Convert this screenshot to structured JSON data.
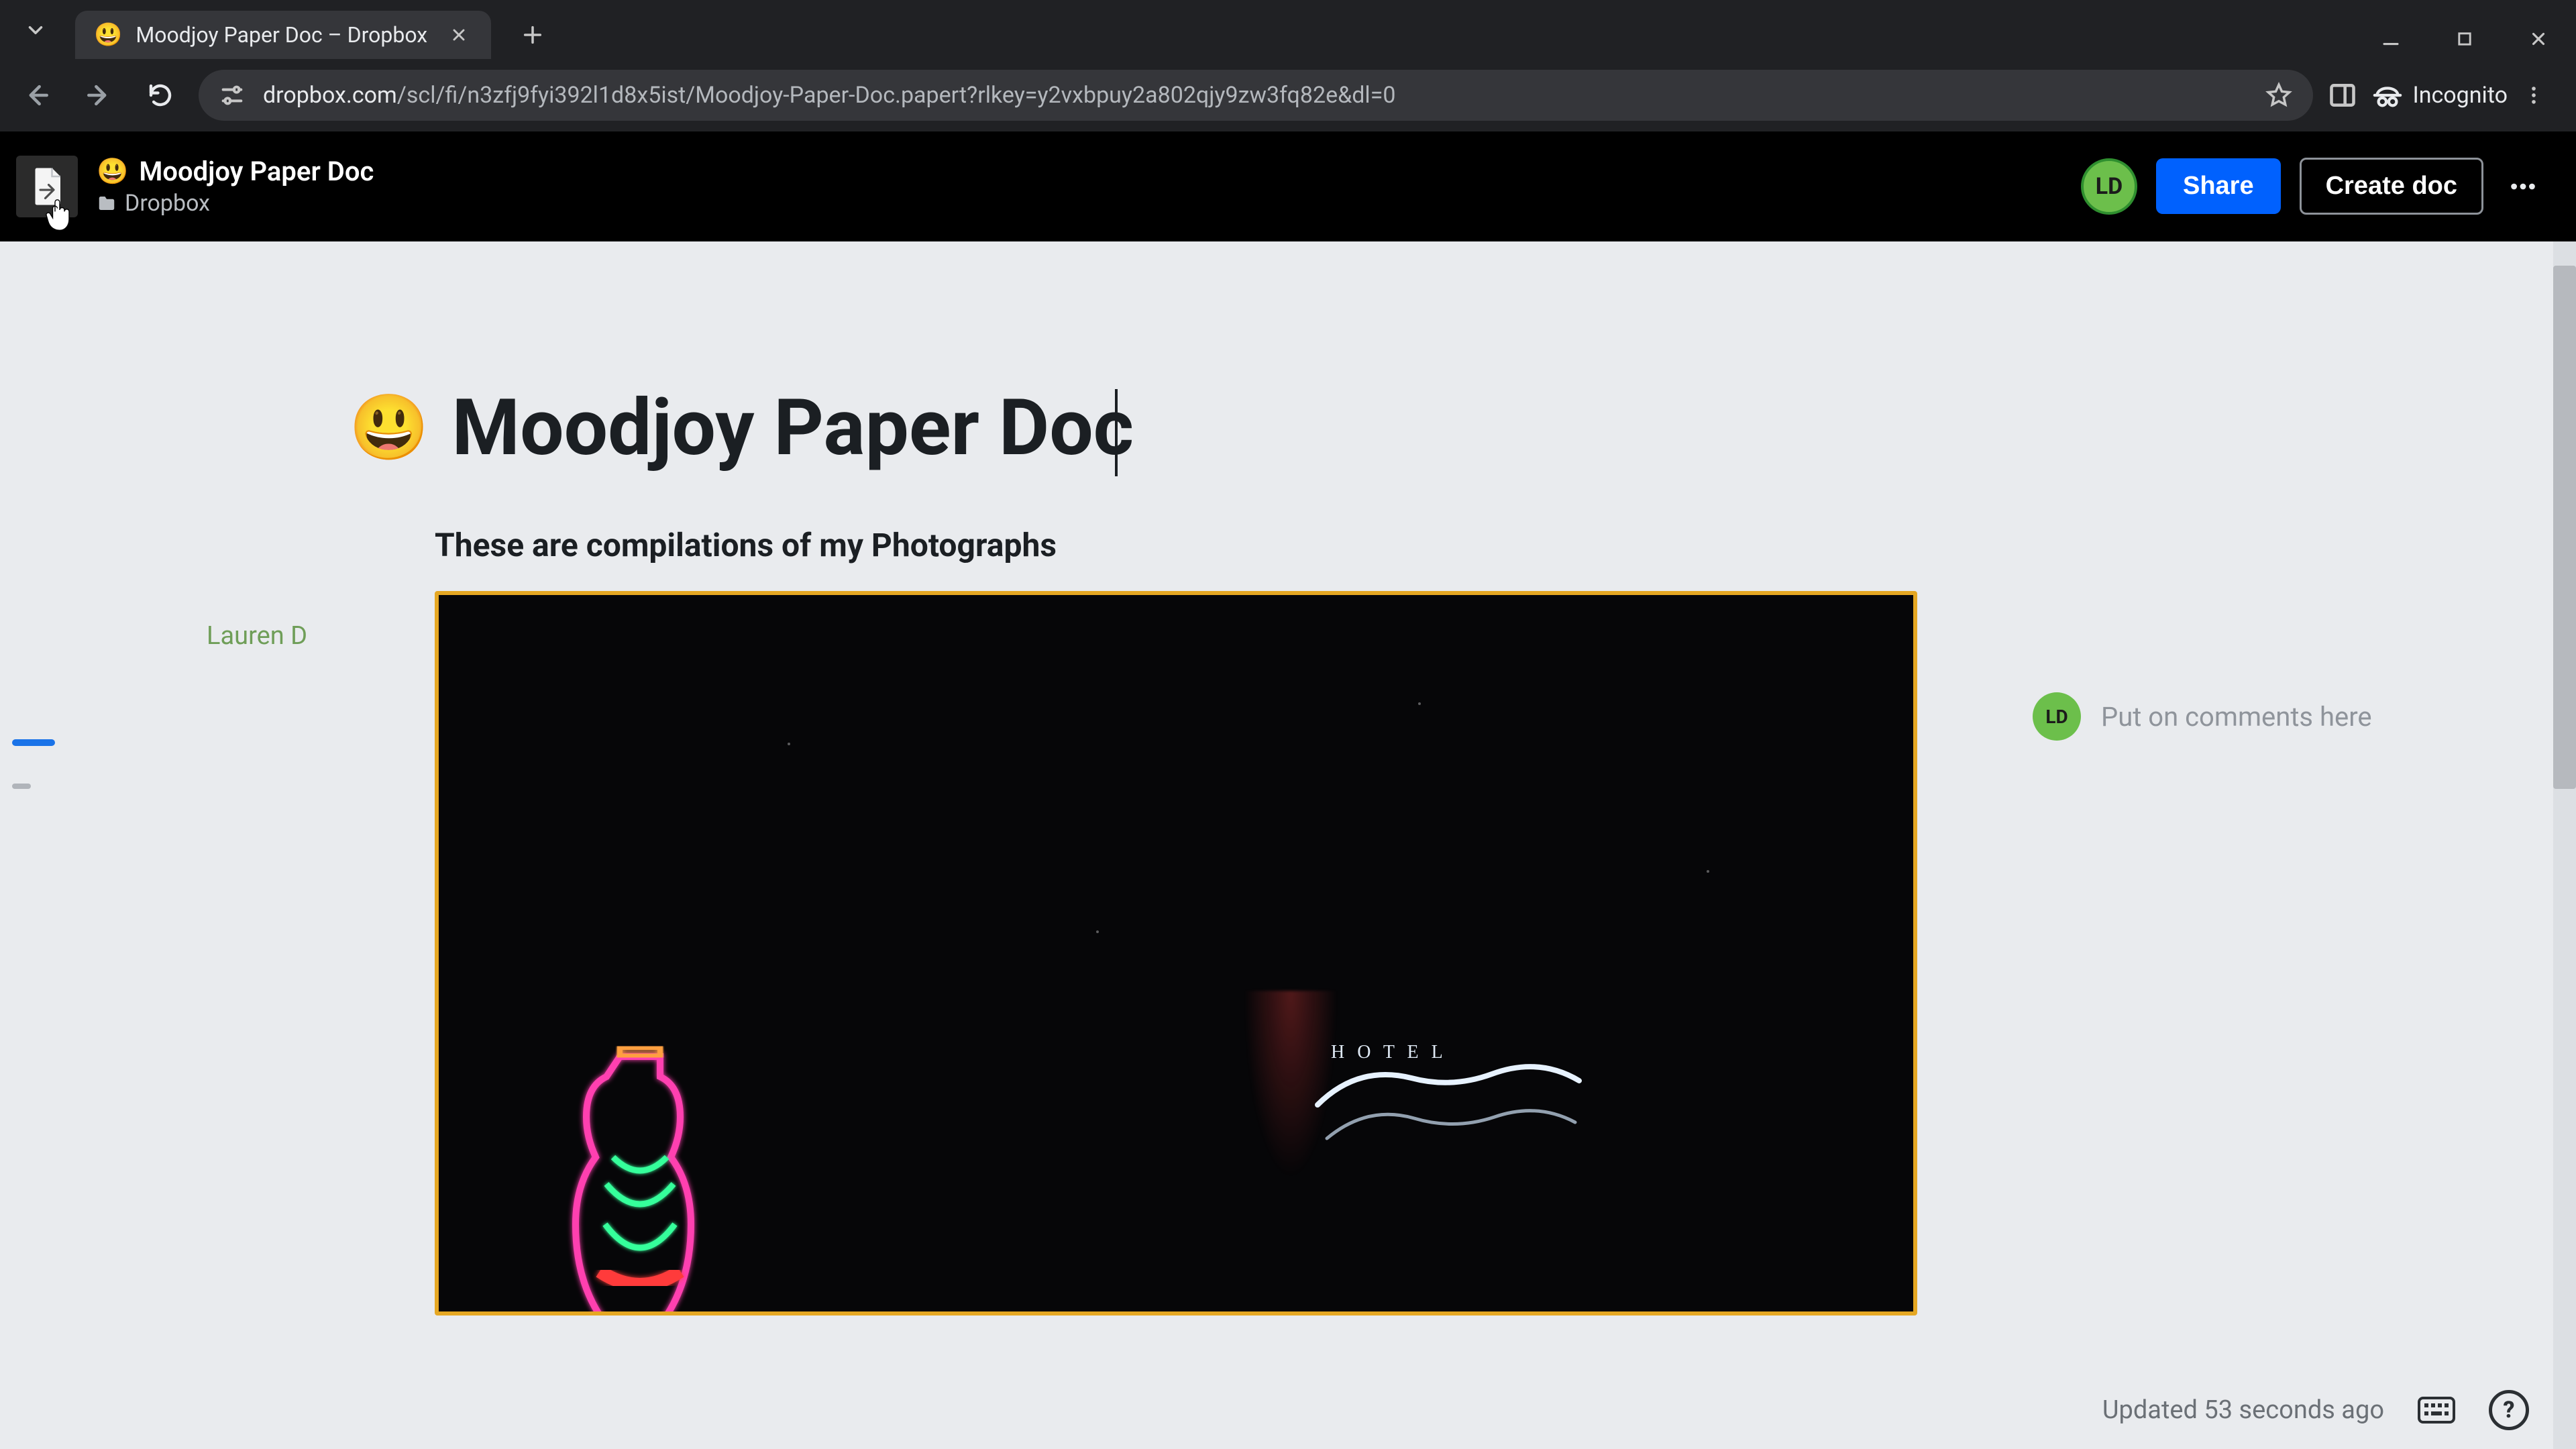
{
  "browser": {
    "tab_title": "Moodjoy Paper Doc – Dropbox",
    "url_host": "dropbox.com",
    "url_path": "/scl/fi/n3zfj9fyi392l1d8x5ist/Moodjoy-Paper-Doc.papert?rlkey=y2vxbpuy2a802qjy9zw3fq82e&dl=0",
    "incognito_label": "Incognito"
  },
  "header": {
    "doc_title": "Moodjoy Paper Doc",
    "emoji": "😃",
    "breadcrumb": "Dropbox",
    "avatar_initials": "LD",
    "share_label": "Share",
    "create_doc_label": "Create doc"
  },
  "document": {
    "h1_emoji": "😃",
    "h1_text": "Moodjoy Paper Doc",
    "author": "Lauren D",
    "subheading": "These are compilations of my Photographs"
  },
  "comments": {
    "avatar": "LD",
    "placeholder": "Put on comments here"
  },
  "status": {
    "updated_text": "Updated 53 seconds ago"
  }
}
